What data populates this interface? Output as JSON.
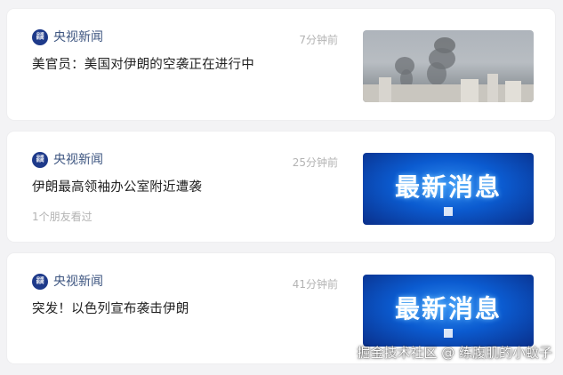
{
  "feed": {
    "items": [
      {
        "source": "央视新闻",
        "logo_text_top": "央视",
        "logo_text_bottom": "新闻",
        "time": "7分钟前",
        "headline": "美官员：美国对伊朗的空袭正在进行中",
        "meta": "",
        "thumbnail_type": "photo"
      },
      {
        "source": "央视新闻",
        "logo_text_top": "央视",
        "logo_text_bottom": "新闻",
        "time": "25分钟前",
        "headline": "伊朗最高领袖办公室附近遭袭",
        "meta": "1个朋友看过",
        "thumbnail_type": "breaking",
        "thumbnail_text": "最新消息"
      },
      {
        "source": "央视新闻",
        "logo_text_top": "央视",
        "logo_text_bottom": "新闻",
        "time": "41分钟前",
        "headline": "突发！以色列宣布袭击伊朗",
        "meta": "",
        "thumbnail_type": "breaking",
        "thumbnail_text": "最新消息"
      }
    ]
  },
  "watermark": "掘金技术社区 @ 练腹肌的小蚊子",
  "colors": {
    "background": "#f3f3f5",
    "card": "#ffffff",
    "source_name": "#3d5580",
    "time": "#b3b3b3",
    "logo": "#1e3a8a",
    "breaking_blue": "#0b5bd0"
  }
}
